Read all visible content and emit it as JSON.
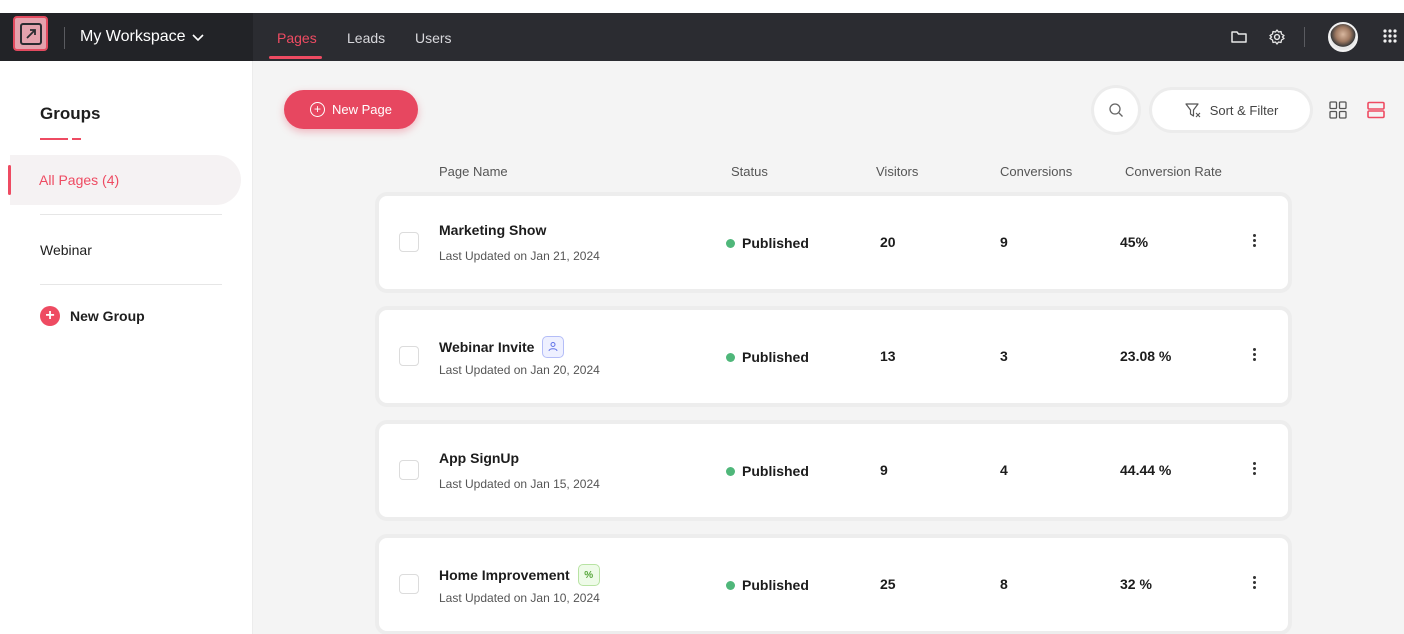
{
  "workspace": {
    "name": "My Workspace"
  },
  "nav": {
    "tabs": [
      {
        "label": "Pages",
        "active": true
      },
      {
        "label": "Leads",
        "active": false
      },
      {
        "label": "Users",
        "active": false
      }
    ]
  },
  "sidebar": {
    "title": "Groups",
    "items": [
      {
        "label": "All Pages (4)",
        "active": true
      },
      {
        "label": "Webinar",
        "active": false
      }
    ],
    "new_group_label": "New Group"
  },
  "toolbar": {
    "new_page_label": "New Page",
    "sort_filter_label": "Sort & Filter"
  },
  "table": {
    "columns": [
      "Page Name",
      "Status",
      "Visitors",
      "Conversions",
      "Conversion Rate"
    ],
    "rows": [
      {
        "name": "Marketing Show",
        "updated": "Last Updated on Jan 21, 2024",
        "status": "Published",
        "visitors": "20",
        "conversions": "9",
        "rate": "45%",
        "badge": null
      },
      {
        "name": "Webinar Invite",
        "updated": "Last Updated on Jan 20, 2024",
        "status": "Published",
        "visitors": "13",
        "conversions": "3",
        "rate": "23.08 %",
        "badge": "users-icon"
      },
      {
        "name": "App SignUp",
        "updated": "Last Updated on Jan 15, 2024",
        "status": "Published",
        "visitors": "9",
        "conversions": "4",
        "rate": "44.44 %",
        "badge": null
      },
      {
        "name": "Home Improvement",
        "updated": "Last Updated on Jan 10, 2024",
        "status": "Published",
        "visitors": "25",
        "conversions": "8",
        "rate": "32 %",
        "badge": "percent-icon"
      }
    ]
  },
  "colors": {
    "accent": "#ee4b62",
    "topbar": "#2b2c31",
    "published": "#4fb77a"
  }
}
